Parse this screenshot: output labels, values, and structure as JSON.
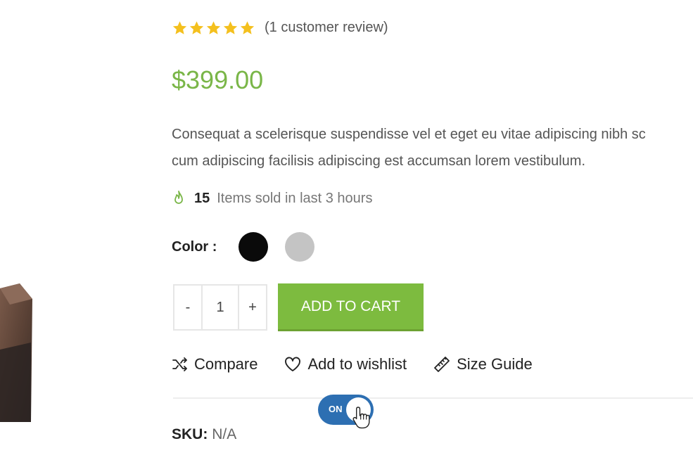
{
  "rating": {
    "stars": 5,
    "review_text": "(1 customer review)",
    "star_color": "#f4c01e"
  },
  "price": "$399.00",
  "price_color": "#7ab648",
  "description": [
    "Consequat a scelerisque suspendisse vel et eget eu vitae adipiscing nibh sc",
    "cum adipiscing facilisis adipiscing est accumsan lorem vestibulum."
  ],
  "sold": {
    "icon": "flame-icon",
    "count": "15",
    "text": "Items sold in last 3 hours"
  },
  "color": {
    "label": "Color :",
    "options": [
      "#0a0a0a",
      "#c4c4c4"
    ]
  },
  "quantity": {
    "decrement": "-",
    "value": "1",
    "increment": "+"
  },
  "cart": {
    "label": "ADD TO CART",
    "color": "#7dbb3f"
  },
  "actions": {
    "compare": "Compare",
    "wishlist": "Add to wishlist",
    "size_guide": "Size Guide"
  },
  "toggle": {
    "label": "ON",
    "color": "#2d6fb2"
  },
  "sku": {
    "label": "SKU:",
    "value": "N/A"
  }
}
